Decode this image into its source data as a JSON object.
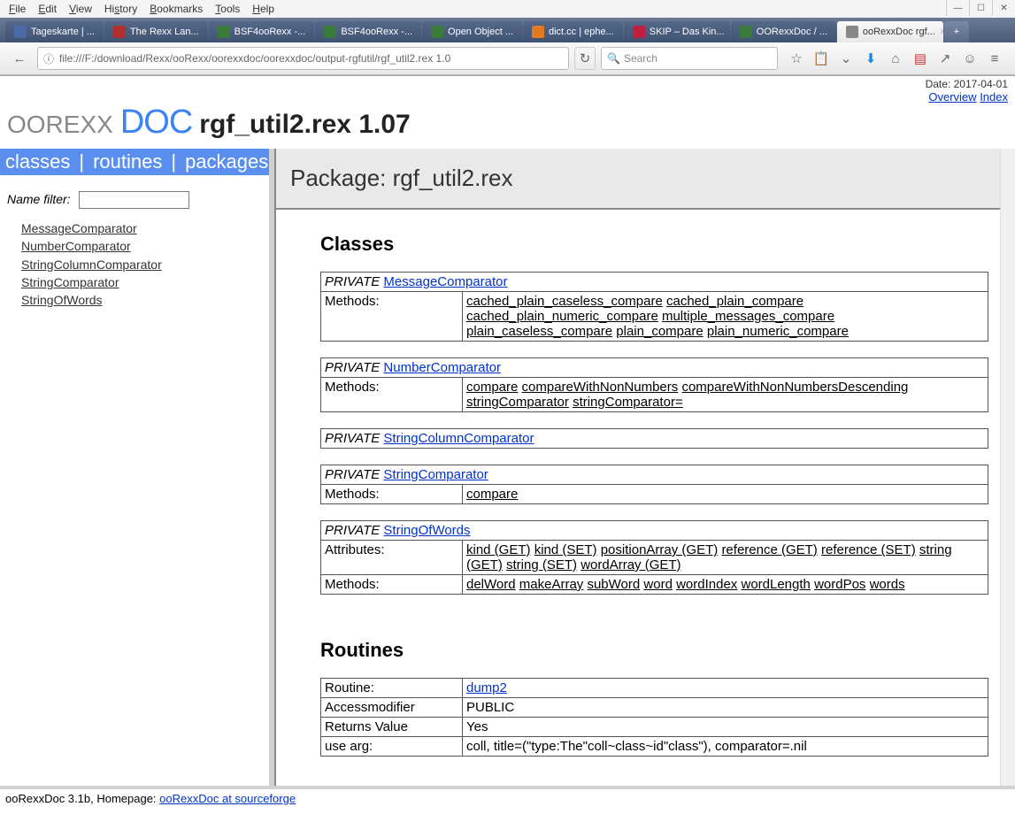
{
  "browser": {
    "menus": [
      "File",
      "Edit",
      "View",
      "History",
      "Bookmarks",
      "Tools",
      "Help"
    ],
    "tabs": [
      {
        "label": "Tageskarte | ...",
        "color": "#4a6aa8"
      },
      {
        "label": "The Rexx Lan...",
        "color": "#b03030"
      },
      {
        "label": "BSF4ooRexx -...",
        "color": "#3a7a3a"
      },
      {
        "label": "BSF4ooRexx -...",
        "color": "#3a7a3a"
      },
      {
        "label": "Open Object ...",
        "color": "#3a7a3a"
      },
      {
        "label": "dict.cc | ephe...",
        "color": "#e07a20"
      },
      {
        "label": "SKIP – Das Kin...",
        "color": "#c02040"
      },
      {
        "label": "OORexxDoc / ...",
        "color": "#3a7a3a"
      },
      {
        "label": "ooRexxDoc rgf...",
        "color": "#888",
        "active": true
      }
    ],
    "url": "file:///F:/download/Rexx/ooRexx/oorexxdoc/oorexxdoc/output-rgfutil/rgf_util2.rex 1.0",
    "search_placeholder": "Search"
  },
  "page": {
    "date": "Date: 2017-04-01",
    "logo1": "OOREXX",
    "logo2": "DOC",
    "title": "rgf_util2.rex 1.07",
    "header_links": [
      "Overview",
      "Index"
    ],
    "side_tabs": [
      "classes",
      "routines",
      "packages"
    ],
    "filter_label": "Name filter:",
    "class_list": [
      "MessageComparator",
      "NumberComparator",
      "StringColumnComparator",
      "StringComparator",
      "StringOfWords"
    ],
    "package_header": "Package: rgf_util2.rex",
    "section_classes": "Classes",
    "section_routines": "Routines",
    "private_label": "PRIVATE",
    "methods_label": "Methods:",
    "attributes_label": "Attributes:",
    "routine_label": "Routine:",
    "access_label": "Accessmodifier",
    "returns_label": "Returns Value",
    "usearg_label": "use arg:",
    "classes": [
      {
        "name": "MessageComparator",
        "methods": [
          "cached_plain_caseless_compare",
          "cached_plain_compare",
          "cached_plain_numeric_compare",
          "multiple_messages_compare",
          "plain_caseless_compare",
          "plain_compare",
          "plain_numeric_compare"
        ]
      },
      {
        "name": "NumberComparator",
        "methods": [
          "compare",
          "compareWithNonNumbers",
          "compareWithNonNumbersDescending",
          "stringComparator",
          "stringComparator="
        ]
      },
      {
        "name": "StringColumnComparator"
      },
      {
        "name": "StringComparator",
        "methods": [
          "compare"
        ]
      },
      {
        "name": "StringOfWords",
        "attributes": [
          "kind (GET)",
          "kind (SET)",
          "positionArray (GET)",
          "reference (GET)",
          "reference (SET)",
          "string (GET)",
          "string (SET)",
          "wordArray (GET)"
        ],
        "methods": [
          "delWord",
          "makeArray",
          "subWord",
          "word",
          "wordIndex",
          "wordLength",
          "wordPos",
          "words"
        ]
      }
    ],
    "routine": {
      "name": "dump2",
      "access": "PUBLIC",
      "returns": "Yes",
      "use_arg": "coll, title=(\"type:The\"coll~class~id\"class\"), comparator=.nil"
    },
    "footer_text": "ooRexxDoc 3.1b, Homepage: ",
    "footer_link": "ooRexxDoc at sourceforge"
  }
}
